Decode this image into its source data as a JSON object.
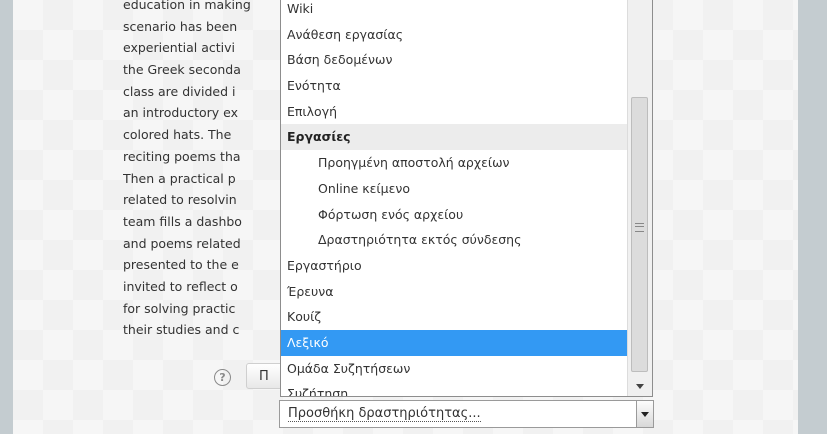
{
  "background_text": {
    "lines": [
      "education in making",
      "scenario has been",
      "experiential activi",
      "the Greek seconda",
      "class are divided i",
      "an introductory ex",
      "colored hats. The",
      "reciting poems tha",
      "Then a practical p",
      "related to resolvin",
      "team fills a dashbo",
      "and poems related",
      "presented to the e",
      "invited to reflect o",
      "for solving practic",
      "their studies and c"
    ]
  },
  "help_icon": "question-circle-icon",
  "behind_button": {
    "label": "Π"
  },
  "dropdown": {
    "options": [
      {
        "label": "Wiki",
        "kind": "option"
      },
      {
        "label": "Ανάθεση εργασίας",
        "kind": "option"
      },
      {
        "label": "Βάση δεδομένων",
        "kind": "option"
      },
      {
        "label": "Ενότητα",
        "kind": "option"
      },
      {
        "label": "Επιλογή",
        "kind": "option"
      },
      {
        "label": "Εργασίες",
        "kind": "group"
      },
      {
        "label": "Προηγμένη αποστολή αρχείων",
        "kind": "child"
      },
      {
        "label": "Online κείμενο",
        "kind": "child"
      },
      {
        "label": "Φόρτωση ενός αρχείου",
        "kind": "child"
      },
      {
        "label": "Δραστηριότητα εκτός σύνδεσης",
        "kind": "child"
      },
      {
        "label": "Εργαστήριο",
        "kind": "option"
      },
      {
        "label": "Έρευνα",
        "kind": "option"
      },
      {
        "label": "Κουίζ",
        "kind": "option"
      },
      {
        "label": "Λεξικό",
        "kind": "option",
        "selected": true
      },
      {
        "label": "Ομάδα Συζητήσεων",
        "kind": "option"
      },
      {
        "label": "Συζήτηση",
        "kind": "option"
      }
    ]
  },
  "select": {
    "value": "Προσθήκη δραστηριότητας..."
  },
  "colors": {
    "highlight": "#3399f3",
    "group_bg": "#ececec"
  }
}
